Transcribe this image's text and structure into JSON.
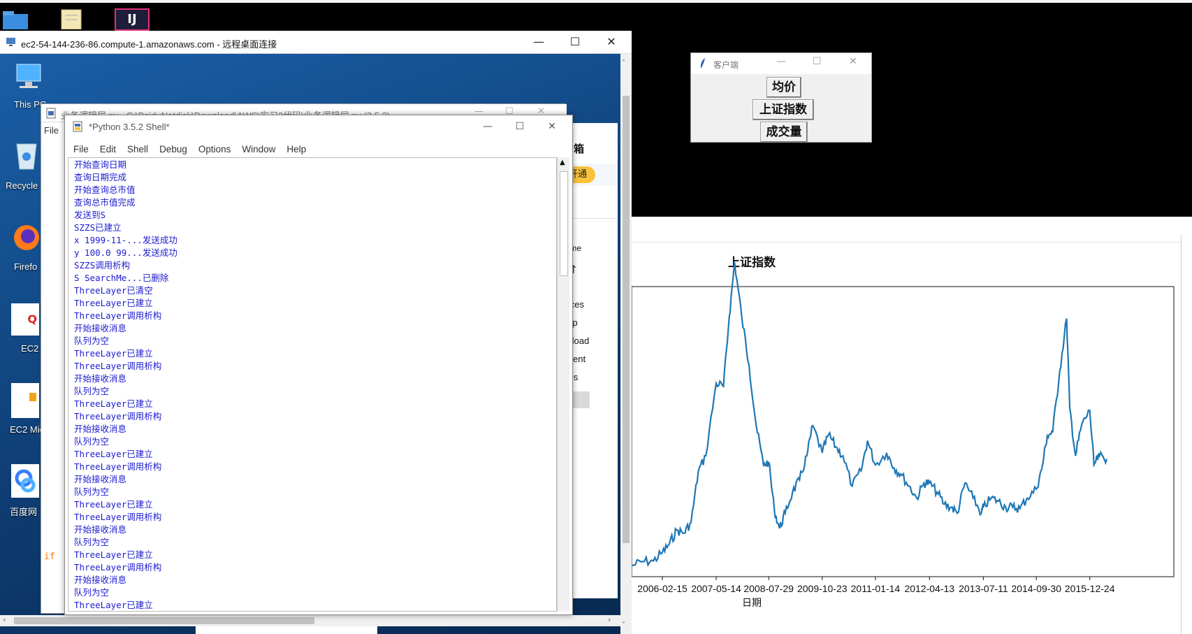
{
  "desktop": {
    "icons": [
      {
        "label": "This PC",
        "icon": "computer-icon"
      },
      {
        "label": "Recycle",
        "icon": "recycle-bin-icon"
      },
      {
        "label": "Firefo",
        "icon": "firefox-icon"
      },
      {
        "label": "EC2 Feedb",
        "icon": "ec2-feedback-icon"
      },
      {
        "label": "EC2 Micros",
        "icon": "ec2-microsoft-icon"
      },
      {
        "label": "百度网",
        "icon": "baidu-netdisk-icon"
      }
    ],
    "taskbar_apps": [
      "folder-icon",
      "notepad-icon",
      "intellij-icon"
    ]
  },
  "rdp": {
    "title": "ec2-54-144-236-86.compute-1.amazonaws.com - 远程桌面连接"
  },
  "idle_editor": {
    "title": "业务逻辑层.py - C:\\BaiduNetdisk\\Download\\AWS\\实习2代码\\业务逻辑层.py (3.5.2)",
    "menu_file": "File",
    "code_fragment": "if"
  },
  "shell": {
    "title": "*Python 3.5.2 Shell*",
    "menu": [
      "File",
      "Edit",
      "Shell",
      "Debug",
      "Options",
      "Window",
      "Help"
    ],
    "lines": [
      "开始查询日期",
      "查询日期完成",
      "开始查询总市值",
      "查询总市值完成",
      "发送到S",
      "SZZS已建立",
      "x 1999-11-...发送成功",
      "y 100.0 99...发送成功",
      "SZZS调用析构",
      "S SearchMe...已删除",
      "ThreeLayer已清空",
      "ThreeLayer已建立",
      "ThreeLayer调用析构",
      "开始接收消息",
      "队列为空",
      "ThreeLayer已建立",
      "ThreeLayer调用析构",
      "开始接收消息",
      "队列为空",
      "ThreeLayer已建立",
      "ThreeLayer调用析构",
      "开始接收消息",
      "队列为空",
      "ThreeLayer已建立",
      "ThreeLayer调用析构",
      "开始接收消息",
      "队列为空",
      "ThreeLayer已建立",
      "ThreeLayer调用析构",
      "开始接收消息",
      "队列为空",
      "ThreeLayer已建立",
      "ThreeLayer调用析构",
      "开始接收消息",
      "队列为空",
      "ThreeLayer已建立",
      "ThreeLayer调用析构"
    ]
  },
  "explorer": {
    "mail_label": "信箱",
    "open_button": "开通",
    "home_label": "Home",
    "items": [
      "acces",
      "ktop",
      "wnload",
      "ument",
      "ures",
      "PC",
      "ork"
    ]
  },
  "client": {
    "title": "客户端",
    "buttons": [
      "均价",
      "上证指数",
      "成交量"
    ]
  },
  "chart_data": {
    "type": "line",
    "title": "上证指数",
    "xlabel": "日期",
    "ylabel": "",
    "x_ticks": [
      "2006-02-15",
      "2007-05-14",
      "2008-07-29",
      "2009-10-23",
      "2011-01-14",
      "2012-04-13",
      "2013-07-11",
      "2014-09-30",
      "2015-12-24"
    ],
    "series_color": "#1f77b4",
    "grid": false,
    "series": [
      {
        "x": [
          "2005-06-01",
          "2005-09-01",
          "2005-12-01",
          "2006-02-15",
          "2006-04-15",
          "2006-06-15",
          "2006-08-15",
          "2006-10-15",
          "2006-12-15",
          "2007-02-15",
          "2007-05-14",
          "2007-07-15",
          "2007-09-01",
          "2007-10-16",
          "2007-12-15",
          "2008-02-15",
          "2008-04-15",
          "2008-06-15",
          "2008-07-29",
          "2008-09-15",
          "2008-10-28",
          "2008-12-15",
          "2009-02-15",
          "2009-04-15",
          "2009-06-15",
          "2009-08-04",
          "2009-10-23",
          "2009-12-15",
          "2010-02-15",
          "2010-04-15",
          "2010-07-02",
          "2010-09-15",
          "2010-11-08",
          "2011-01-14",
          "2011-04-18",
          "2011-06-20",
          "2011-08-15",
          "2011-10-24",
          "2011-12-28",
          "2012-02-27",
          "2012-04-13",
          "2012-06-15",
          "2012-08-15",
          "2012-10-15",
          "2012-12-03",
          "2013-02-06",
          "2013-04-15",
          "2013-06-25",
          "2013-07-11",
          "2013-09-15",
          "2013-11-15",
          "2014-01-15",
          "2014-03-15",
          "2014-05-15",
          "2014-07-15",
          "2014-09-30",
          "2014-11-15",
          "2014-12-31",
          "2015-02-15",
          "2015-04-15",
          "2015-06-12",
          "2015-07-08",
          "2015-08-26",
          "2015-10-15",
          "2015-12-24",
          "2016-01-28",
          "2016-03-15",
          "2016-05-15"
        ],
        "y": [
          1080,
          1150,
          1160,
          1300,
          1440,
          1670,
          1620,
          1800,
          2650,
          2900,
          4100,
          4050,
          5200,
          6100,
          5200,
          4400,
          3400,
          2750,
          2800,
          2000,
          1700,
          1950,
          2300,
          2500,
          2900,
          3400,
          2950,
          3250,
          3050,
          2900,
          2400,
          2650,
          3150,
          2750,
          2950,
          2700,
          2600,
          2400,
          2200,
          2450,
          2450,
          2300,
          2100,
          2050,
          1950,
          2450,
          2200,
          1950,
          2050,
          2200,
          2150,
          2050,
          2050,
          2030,
          2200,
          2350,
          2680,
          3230,
          3300,
          4300,
          5170,
          3700,
          2900,
          3400,
          3650,
          2750,
          2900,
          2850
        ]
      }
    ],
    "ylim": [
      900,
      5700
    ]
  }
}
